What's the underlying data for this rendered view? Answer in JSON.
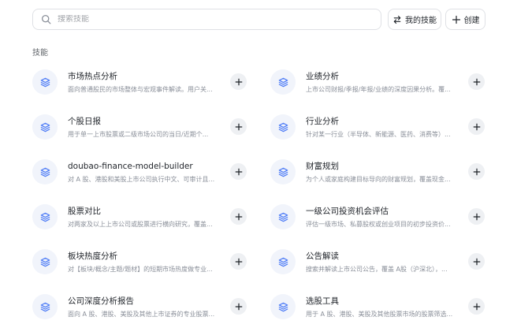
{
  "search": {
    "placeholder": "搜索技能"
  },
  "toolbar": {
    "my_skills_label": "我的技能",
    "create_label": "创建"
  },
  "section": {
    "title": "技能"
  },
  "skills": [
    {
      "name": "市场热点分析",
      "desc": "面向普通股民的市场整体与宏观事件解读。用户关..."
    },
    {
      "name": "业绩分析",
      "desc": "上市公司财报/季报/年报/业绩的深度因果分析。覆..."
    },
    {
      "name": "个股日报",
      "desc": "用于单一上市股票或二级市场公司的当日/近期个..."
    },
    {
      "name": "行业分析",
      "desc": "针对某一行业（半导体、新能源、医药、消费等）..."
    },
    {
      "name": "doubao-finance-model-builder",
      "desc": "对 A 股、港股和美股上市公司执行中文、可审计且..."
    },
    {
      "name": "财富规划",
      "desc": "为个人或家庭构建目标导向的财富规划，覆盖现金..."
    },
    {
      "name": "股票对比",
      "desc": "对两家及以上上市公司或股票进行横向研究，覆盖..."
    },
    {
      "name": "一级公司投资机会评估",
      "desc": "评估一级市场、私募股权或创业项目的初步投资价..."
    },
    {
      "name": "板块热度分析",
      "desc": "对【板块/概念/主题/题材】的短期市场热度做专业..."
    },
    {
      "name": "公告解读",
      "desc": "搜索并解读上市公司公告，覆盖 A股（沪深北），..."
    },
    {
      "name": "公司深度分析报告",
      "desc": "面向 A 股、港股、美股及其他上市证券的专业股票..."
    },
    {
      "name": "选股工具",
      "desc": "用于 A 股、港股、美股及其他股票市场的股票筛选..."
    }
  ]
}
